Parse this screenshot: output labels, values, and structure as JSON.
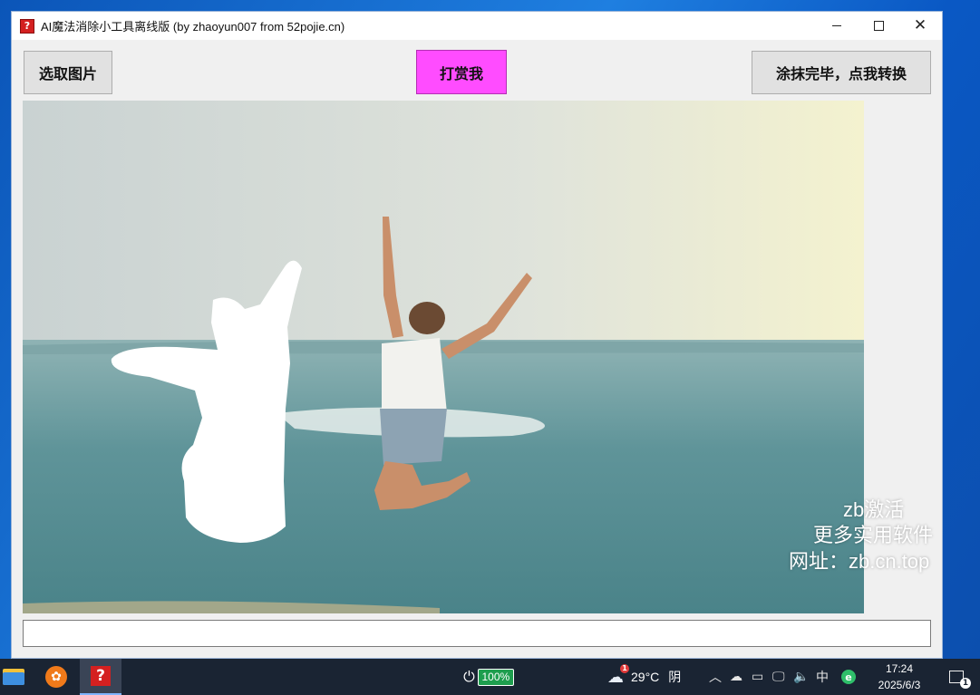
{
  "window": {
    "title": "AI魔法消除小工具离线版  (by zhaoyun007 from 52pojie.cn)",
    "app_icon": "question-icon",
    "controls": {
      "minimize": "minimize-icon",
      "maximize": "maximize-icon",
      "close": "close-icon"
    }
  },
  "toolbar": {
    "select_image_label": "选取图片",
    "reward_label": "打赏我",
    "reward_color": "#ff4cff",
    "convert_label": "涂抹完毕，点我转换"
  },
  "status_input": {
    "value": ""
  },
  "watermark": {
    "line1": "zb激活",
    "line2": "更多实用软件",
    "line3": "网址：zb.cn.top"
  },
  "taskbar": {
    "battery_percent": "100%",
    "weather": {
      "temperature": "29°C",
      "condition": "阴",
      "badge": "1"
    },
    "ime": "中",
    "time": "17:24",
    "date": "2025/6/3",
    "notification_badge": "1"
  }
}
